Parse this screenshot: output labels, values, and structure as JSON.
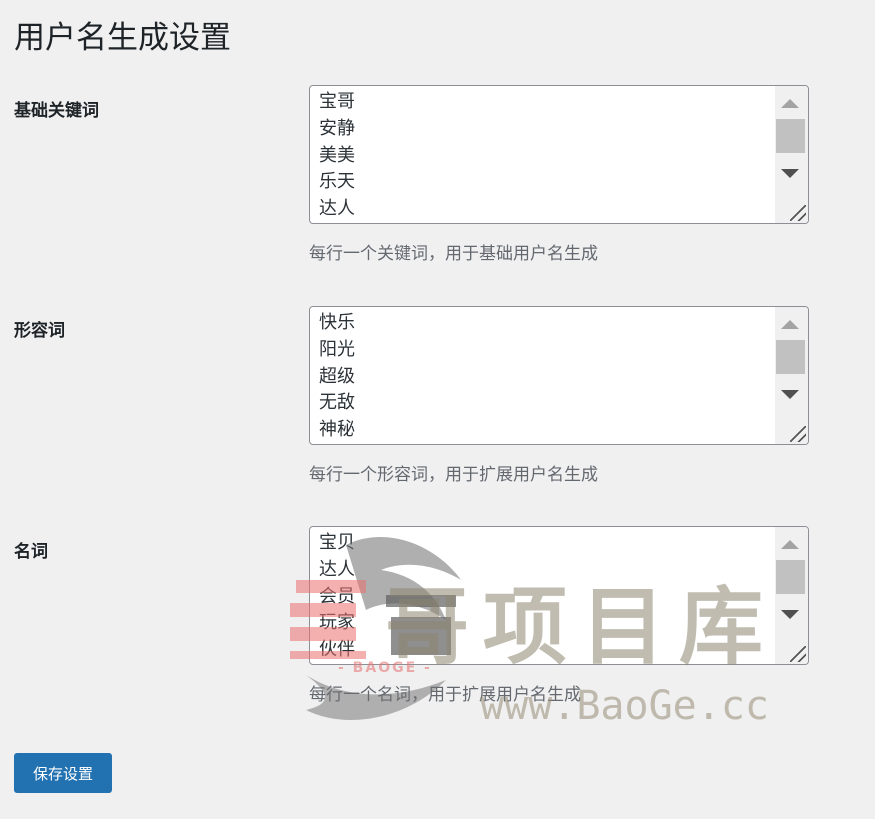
{
  "page": {
    "title": "用户名生成设置"
  },
  "fields": [
    {
      "label": "基础关键词",
      "lines": [
        "宝哥",
        "安静",
        "美美",
        "乐天",
        "达人"
      ],
      "description": "每行一个关键词，用于基础用户名生成"
    },
    {
      "label": "形容词",
      "lines": [
        "快乐",
        "阳光",
        "超级",
        "无敌",
        "神秘"
      ],
      "description": "每行一个形容词，用于扩展用户名生成"
    },
    {
      "label": "名词",
      "lines": [
        "宝贝",
        "达人",
        "会员",
        "玩家",
        "伙伴"
      ],
      "description": "每行一个名词，用于扩展用户名生成"
    }
  ],
  "actions": {
    "save_label": "保存设置"
  },
  "watermark": {
    "logo_text": "哥项目库",
    "sub_text": "- BAOGE -",
    "url": "www.BaoGe.cc"
  },
  "colors": {
    "primary_button": "#2271b1",
    "background": "#f0f0f1"
  }
}
